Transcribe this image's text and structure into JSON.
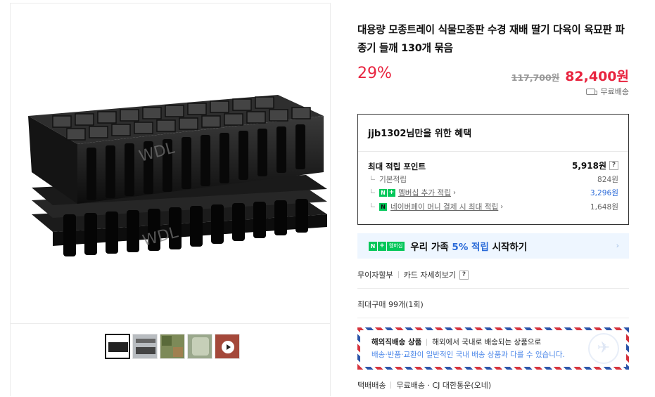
{
  "product": {
    "title": "대용량 모종트레이 식물모종판 수경 재배 딸기 다육이 육묘판 파종기 들깨 130개 묶음",
    "discount": "29%",
    "original_price": "117,700원",
    "sale_price": "82,400원",
    "shipping_badge": "무료배송",
    "image_watermark": "WDL"
  },
  "benefits": {
    "title": "jjb1302님만을 위한 혜택",
    "max_point_label": "최대 적립 포인트",
    "max_point_value": "5,918원",
    "help": "?",
    "items": [
      {
        "label": "기본적립",
        "value": "824원"
      },
      {
        "label": "멤버십 추가 적립",
        "value": "3,296원",
        "chev": "›"
      },
      {
        "label": "네이버페이 머니 결제 시 최대 적립",
        "value": "1,648원",
        "chev": "›"
      }
    ]
  },
  "membership_banner": {
    "badge_n": "N",
    "badge_plus": "+",
    "badge_text": "멤버십",
    "text_before": "우리 가족 ",
    "highlight": "5% 적립",
    "text_after": " 시작하기",
    "chevron": "›"
  },
  "installment": {
    "label": "무이자할부",
    "card_detail": "카드 자세히보기",
    "help": "?"
  },
  "max_purchase": "최대구매 99개(1회)",
  "overseas": {
    "title": "해외직배송 상품",
    "title_desc": "해외에서 국내로 배송되는 상품으로",
    "desc": "배송·반품·교환이 일반적인 국내 배송 상품과 다를 수 있습니다."
  },
  "delivery": {
    "method": "택배배송",
    "detail": "무료배송 · CJ 대한통운(오네)"
  },
  "thumbnails": [
    {
      "name": "thumb-tray-stack",
      "color": "#2a2a2a"
    },
    {
      "name": "thumb-tray-grey",
      "color": "#9aa0a6"
    },
    {
      "name": "thumb-seedlings",
      "color": "#7a8a5a"
    },
    {
      "name": "thumb-plants",
      "color": "#8a9a7a"
    },
    {
      "name": "thumb-video",
      "color": "#a44a3a"
    }
  ],
  "colors": {
    "accent_red": "#e8243f",
    "naver_green": "#03c75a",
    "link_blue": "#2a6ad8"
  }
}
